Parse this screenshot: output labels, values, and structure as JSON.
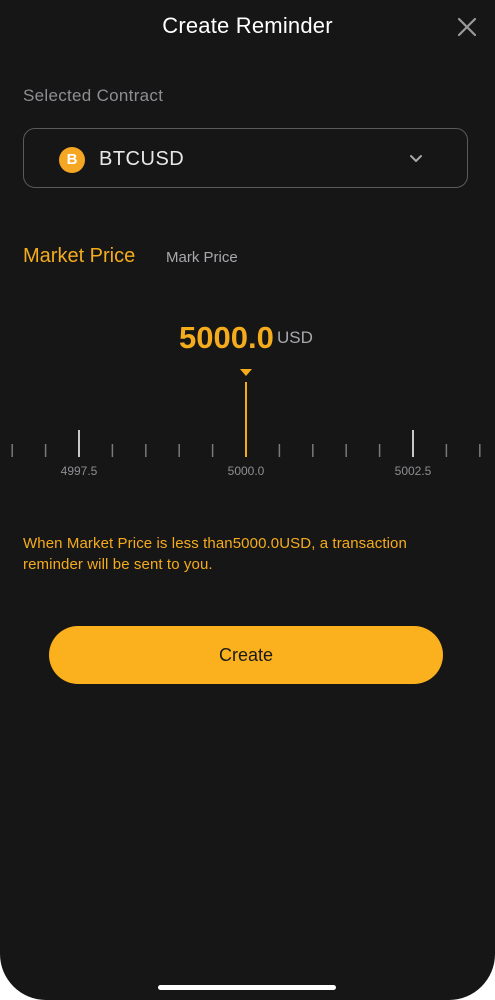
{
  "header": {
    "title": "Create Reminder",
    "close_icon": "close-icon"
  },
  "contract": {
    "section_label": "Selected Contract",
    "coin_glyph": "B",
    "coin_color": "#f5a623",
    "name": "BTCUSD",
    "dropdown_icon": "chevron-down-icon"
  },
  "price_tabs": {
    "active": "Market Price",
    "inactive": "Mark Price"
  },
  "price": {
    "value": "5000.0",
    "unit": "USD"
  },
  "ruler": {
    "center_value": 5000.0,
    "step": 0.5,
    "labels": [
      "4997.5",
      "5000.0",
      "5002.5"
    ]
  },
  "hint": "When Market Price is less than5000.0USD, a transaction reminder will be sent to you.",
  "actions": {
    "create_label": "Create"
  },
  "colors": {
    "accent": "#f5ac1c",
    "button": "#fbb11d",
    "background": "#161616"
  }
}
